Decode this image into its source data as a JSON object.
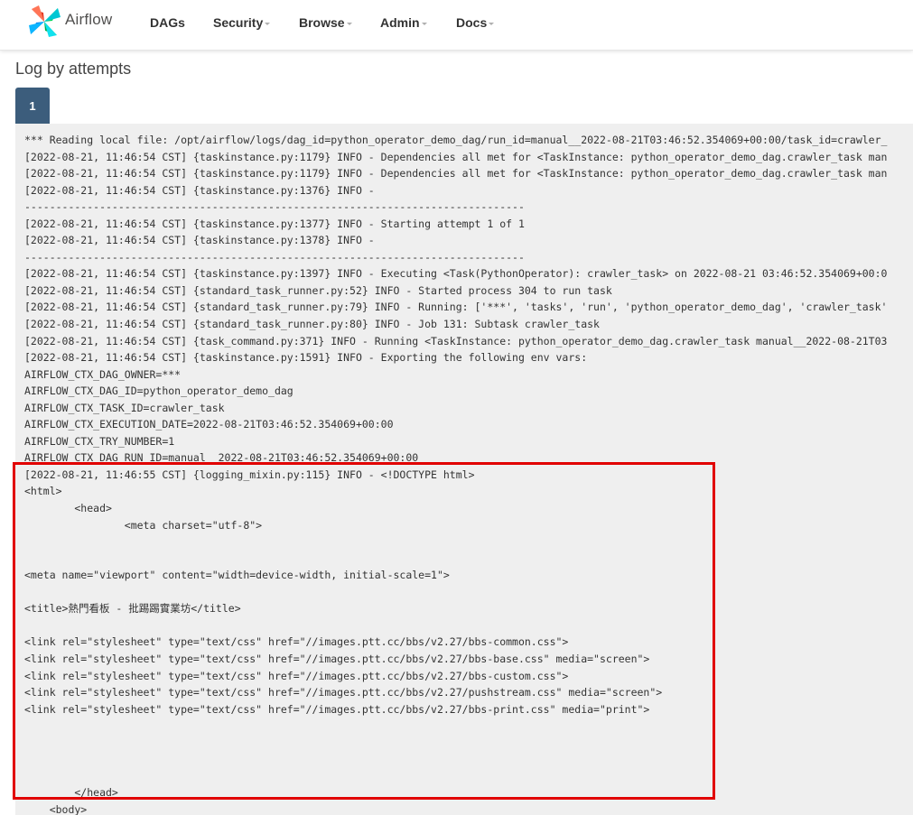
{
  "navbar": {
    "brand": "Airflow",
    "items": [
      {
        "label": "DAGs",
        "dropdown": false
      },
      {
        "label": "Security",
        "dropdown": true
      },
      {
        "label": "Browse",
        "dropdown": true
      },
      {
        "label": "Admin",
        "dropdown": true
      },
      {
        "label": "Docs",
        "dropdown": true
      }
    ]
  },
  "page": {
    "title": "Log by attempts",
    "attempts": [
      "1"
    ],
    "active_attempt": "1"
  },
  "colors": {
    "attempt_tab": "#3c5d7c",
    "log_background": "#efefef",
    "highlight_border": "#e10000",
    "logo_blue": "#017cee",
    "logo_green": "#00ad46",
    "logo_teal": "#04d659",
    "logo_red": "#e43921"
  },
  "log": {
    "lines": [
      "*** Reading local file: /opt/airflow/logs/dag_id=python_operator_demo_dag/run_id=manual__2022-08-21T03:46:52.354069+00:00/task_id=crawler_",
      "[2022-08-21, 11:46:54 CST] {taskinstance.py:1179} INFO - Dependencies all met for <TaskInstance: python_operator_demo_dag.crawler_task man",
      "[2022-08-21, 11:46:54 CST] {taskinstance.py:1179} INFO - Dependencies all met for <TaskInstance: python_operator_demo_dag.crawler_task man",
      "[2022-08-21, 11:46:54 CST] {taskinstance.py:1376} INFO -",
      "--------------------------------------------------------------------------------",
      "[2022-08-21, 11:46:54 CST] {taskinstance.py:1377} INFO - Starting attempt 1 of 1",
      "[2022-08-21, 11:46:54 CST] {taskinstance.py:1378} INFO -",
      "--------------------------------------------------------------------------------",
      "[2022-08-21, 11:46:54 CST] {taskinstance.py:1397} INFO - Executing <Task(PythonOperator): crawler_task> on 2022-08-21 03:46:52.354069+00:0",
      "[2022-08-21, 11:46:54 CST] {standard_task_runner.py:52} INFO - Started process 304 to run task",
      "[2022-08-21, 11:46:54 CST] {standard_task_runner.py:79} INFO - Running: ['***', 'tasks', 'run', 'python_operator_demo_dag', 'crawler_task'",
      "[2022-08-21, 11:46:54 CST] {standard_task_runner.py:80} INFO - Job 131: Subtask crawler_task",
      "[2022-08-21, 11:46:54 CST] {task_command.py:371} INFO - Running <TaskInstance: python_operator_demo_dag.crawler_task manual__2022-08-21T03",
      "[2022-08-21, 11:46:54 CST] {taskinstance.py:1591} INFO - Exporting the following env vars:",
      "AIRFLOW_CTX_DAG_OWNER=***",
      "AIRFLOW_CTX_DAG_ID=python_operator_demo_dag",
      "AIRFLOW_CTX_TASK_ID=crawler_task",
      "AIRFLOW_CTX_EXECUTION_DATE=2022-08-21T03:46:52.354069+00:00",
      "AIRFLOW_CTX_TRY_NUMBER=1",
      "AIRFLOW_CTX_DAG_RUN_ID=manual__2022-08-21T03:46:52.354069+00:00",
      "[2022-08-21, 11:46:55 CST] {logging_mixin.py:115} INFO - <!DOCTYPE html>",
      "<html>",
      "        <head>",
      "                <meta charset=\"utf-8\">",
      "",
      "",
      "<meta name=\"viewport\" content=\"width=device-width, initial-scale=1\">",
      "",
      "<title>熱門看板 - 批踢踢實業坊</title>",
      "",
      "<link rel=\"stylesheet\" type=\"text/css\" href=\"//images.ptt.cc/bbs/v2.27/bbs-common.css\">",
      "<link rel=\"stylesheet\" type=\"text/css\" href=\"//images.ptt.cc/bbs/v2.27/bbs-base.css\" media=\"screen\">",
      "<link rel=\"stylesheet\" type=\"text/css\" href=\"//images.ptt.cc/bbs/v2.27/bbs-custom.css\">",
      "<link rel=\"stylesheet\" type=\"text/css\" href=\"//images.ptt.cc/bbs/v2.27/pushstream.css\" media=\"screen\">",
      "<link rel=\"stylesheet\" type=\"text/css\" href=\"//images.ptt.cc/bbs/v2.27/bbs-print.css\" media=\"print\">",
      "",
      "",
      "",
      "",
      "        </head>",
      "    <body>"
    ]
  }
}
